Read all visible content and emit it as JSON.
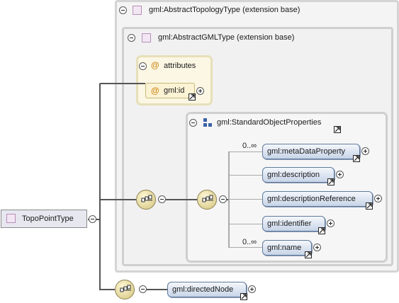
{
  "diagram": {
    "root": {
      "label": "TopoPointType"
    },
    "topology_base": {
      "label": "gml:AbstractTopologyType (extension base)"
    },
    "gml_base": {
      "label": "gml:AbstractGMLType (extension base)"
    },
    "attributes": {
      "header": "attributes",
      "at_symbol": "@",
      "attr_label": "gml:id"
    },
    "group": {
      "label": "gml:StandardObjectProperties"
    },
    "elements": [
      {
        "label": "gml:metaDataProperty",
        "occurs": "0..∞"
      },
      {
        "label": "gml:description",
        "occurs": ""
      },
      {
        "label": "gml:descriptionReference",
        "occurs": ""
      },
      {
        "label": "gml:identifier",
        "occurs": ""
      },
      {
        "label": "gml:name",
        "occurs": "0..∞"
      }
    ],
    "directed": {
      "label": "gml:directedNode"
    }
  },
  "colors": {
    "element_fill": "#c7d4e7",
    "attribute_fill": "#fbf7e4",
    "compositor_fill": "#ddd091",
    "type_icon": "#f3e6f3"
  },
  "icons": [
    "collapse-icon",
    "expand-icon",
    "type-icon",
    "attribute-icon",
    "group-icon",
    "sequence-icon",
    "link-arrow-icon"
  ]
}
